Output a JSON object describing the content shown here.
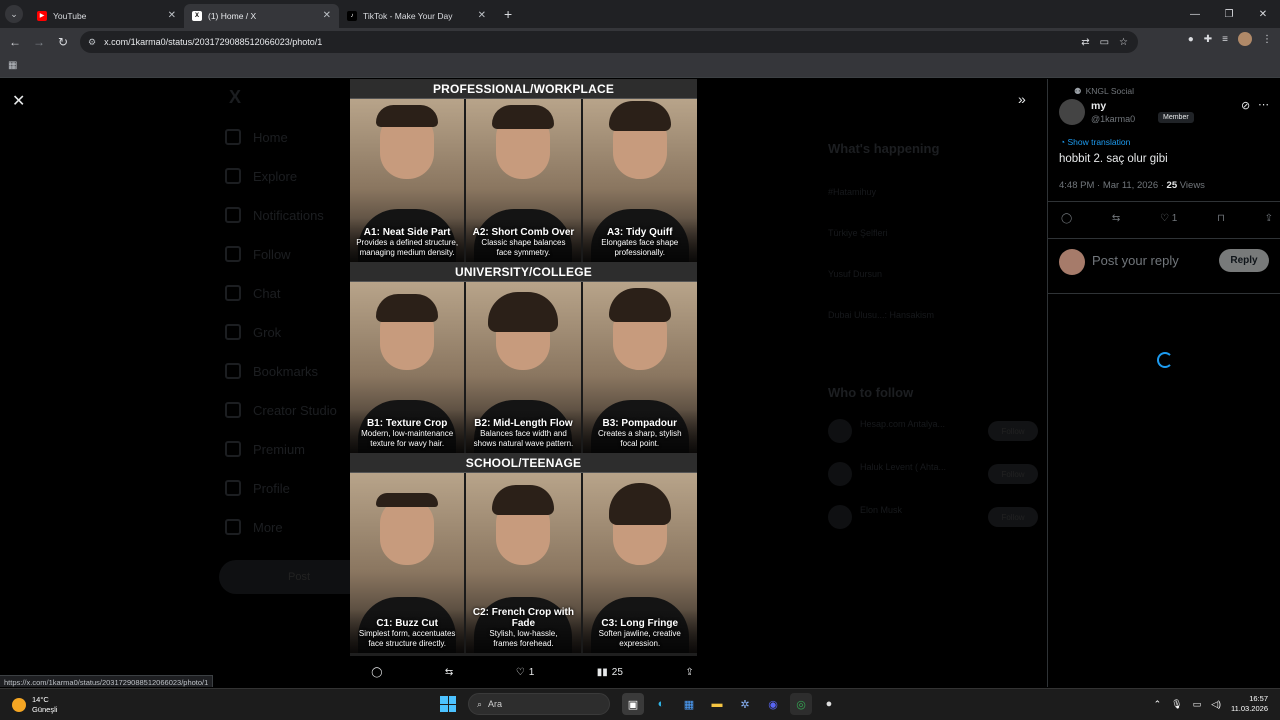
{
  "browser": {
    "tabs": [
      {
        "title": "YouTube",
        "icon": "youtube-icon",
        "color": "#ff0000",
        "active": false
      },
      {
        "title": "(1) Home / X",
        "icon": "x-logo-icon",
        "color": "#ffffff",
        "active": true
      },
      {
        "title": "TikTok - Make Your Day",
        "icon": "tiktok-icon",
        "color": "#ffffff",
        "active": false
      }
    ],
    "url": "x.com/1karma0/status/2031729088512066023/photo/1",
    "status_url": "https://x.com/1karma0/status/2031729088512066023/photo/1"
  },
  "background": {
    "nav": [
      "Home",
      "Explore",
      "Notifications",
      "Follow",
      "Chat",
      "Grok",
      "Bookmarks",
      "Creator Studio",
      "Premium",
      "Profile",
      "More"
    ],
    "post_button": "Post",
    "whats_happening": "What's happening",
    "trends": [
      "#Hatamihuy",
      "Türkiye Şelfleri",
      "Yusuf Dursun",
      "Dubai Ulusu...: Hansakism"
    ],
    "who_to_follow": "Who to follow",
    "follow_suggestions": [
      {
        "name": "Hesap.com Antalya..."
      },
      {
        "name": "Haluk Levent ( Ahta..."
      },
      {
        "name": "Elon Musk"
      }
    ],
    "follow_label": "Follow"
  },
  "poster": {
    "sections": [
      {
        "title": "PROFESSIONAL/WORKPLACE",
        "items": [
          {
            "title": "A1: Neat Side Part",
            "desc1": "Provides a defined structure,",
            "desc2": "managing medium density."
          },
          {
            "title": "A2: Short Comb Over",
            "desc1": "Classic shape balances",
            "desc2": "face symmetry."
          },
          {
            "title": "A3: Tidy Quiff",
            "desc1": "Elongates face shape",
            "desc2": "professionally."
          }
        ]
      },
      {
        "title": "UNIVERSITY/COLLEGE",
        "items": [
          {
            "title": "B1: Texture Crop",
            "desc1": "Modern, low-maintenance",
            "desc2": "texture for wavy hair."
          },
          {
            "title": "B2: Mid-Length Flow",
            "desc1": "Balances face width and",
            "desc2": "shows natural wave pattern."
          },
          {
            "title": "B3: Pompadour",
            "desc1": "Creates a sharp, stylish",
            "desc2": "focal point."
          }
        ]
      },
      {
        "title": "SCHOOL/TEENAGE",
        "items": [
          {
            "title": "C1: Buzz Cut",
            "desc1": "Simplest form, accentuates",
            "desc2": "face structure directly."
          },
          {
            "title": "C2: French Crop with Fade",
            "desc1": "Stylish, low-hassle,",
            "desc2": "frames forehead."
          },
          {
            "title": "C3: Long Fringe",
            "desc1": "Soften jawline, creative",
            "desc2": "expression."
          }
        ]
      }
    ]
  },
  "photo_actions": {
    "likes": "1",
    "views": "25"
  },
  "post": {
    "community": "KNGL Social",
    "name": "my",
    "handle": "@1karma0",
    "badge": "Member",
    "translate": "Show translation",
    "text": "hobbit 2. saç olur gibi",
    "time": "4:48 PM · Mar 11, 2026 · ",
    "views": "25",
    "views_label": " Views",
    "likes": "1",
    "reply_placeholder": "Post your reply",
    "reply_button": "Reply"
  },
  "taskbar": {
    "temp": "14°C",
    "weather": "Güneşli",
    "search_placeholder": "Ara",
    "time": "16:57",
    "date": "11.03.2026"
  }
}
